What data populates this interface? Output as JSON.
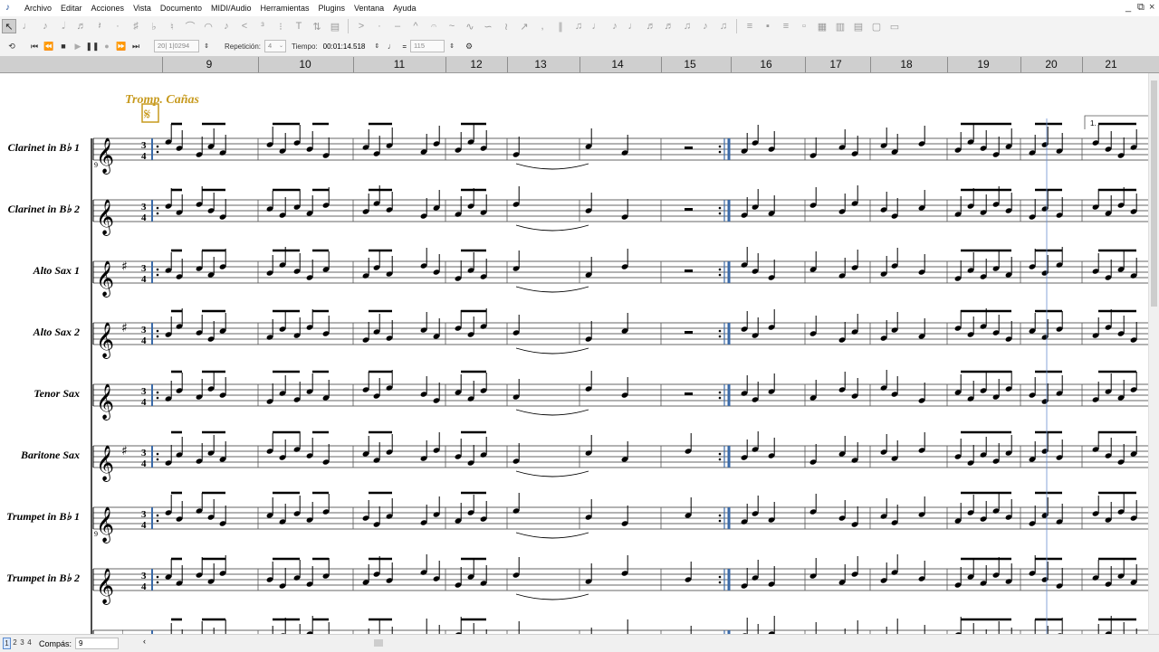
{
  "menu": {
    "items": [
      "Archivo",
      "Editar",
      "Acciones",
      "Vista",
      "Documento",
      "MIDI/Audio",
      "Herramientas",
      "Plugins",
      "Ventana",
      "Ayuda"
    ]
  },
  "window_controls": {
    "minimize": "_",
    "restore": "⧉",
    "close": "×"
  },
  "playback": {
    "position_value": "20| 1|0294",
    "repeat_label": "Repetición:",
    "repeat_value": "4",
    "time_label": "Tiempo:",
    "time_value": "00:01:14.518",
    "tempo_equals": "=",
    "tempo_value": "115"
  },
  "ruler": {
    "numbers": [
      "9",
      "10",
      "11",
      "12",
      "13",
      "14",
      "15",
      "16",
      "17",
      "18",
      "19",
      "20",
      "21"
    ]
  },
  "score": {
    "expression_text": "Tromp. Cañas",
    "segno_symbol": "𝄋",
    "ending_label": "1.",
    "instruments": [
      {
        "name": "Clarinet in B♭ 1",
        "clef": "𝄞",
        "key": "",
        "transpose_mark": "9"
      },
      {
        "name": "Clarinet in B♭ 2",
        "clef": "𝄞",
        "key": "",
        "transpose_mark": ""
      },
      {
        "name": "Alto Sax 1",
        "clef": "𝄞",
        "key": "♯",
        "transpose_mark": ""
      },
      {
        "name": "Alto Sax 2",
        "clef": "𝄞",
        "key": "♯",
        "transpose_mark": ""
      },
      {
        "name": "Tenor Sax",
        "clef": "𝄞",
        "key": "",
        "transpose_mark": ""
      },
      {
        "name": "Baritone Sax",
        "clef": "𝄞",
        "key": "♯",
        "transpose_mark": ""
      },
      {
        "name": "Trumpet in B♭ 1",
        "clef": "𝄞",
        "key": "",
        "transpose_mark": "9"
      },
      {
        "name": "Trumpet in B♭ 2",
        "clef": "𝄞",
        "key": "",
        "transpose_mark": ""
      },
      {
        "name": "",
        "clef": "𝄢",
        "key": "♭",
        "transpose_mark": ""
      }
    ]
  },
  "statusbar": {
    "pages": [
      "1",
      "2",
      "3",
      "4"
    ],
    "measure_label": "Compás:",
    "measure_value": "9"
  },
  "colors": {
    "expression": "#c79a1e",
    "barline_blue": "#3a6aa8",
    "ruler_bg": "#cfcfcf"
  }
}
